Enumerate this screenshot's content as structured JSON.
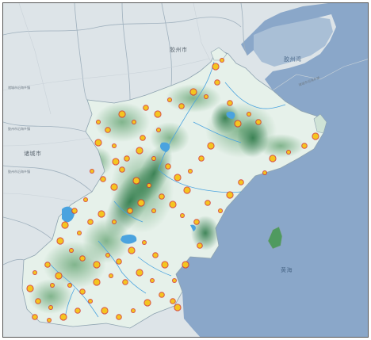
{
  "map": {
    "labels": {
      "city_east": "胶州市",
      "city_west": "诸城市",
      "bay": "胶州湾",
      "sea": "黄海",
      "road_1": "胶州市沿海乡镇",
      "road_2": "胶州市沿海乡镇",
      "road_3": "诸城市沿海乡镇",
      "road_4": "诸城市沿海乡镇"
    },
    "colors": {
      "sea": "#8aa7c9",
      "land_background": "#dde4e8",
      "terrain_low": "#e9f3ee",
      "terrain_high": "#2f7a4a",
      "river": "#4aa3df",
      "marker_fill": "#f4c51f",
      "marker_ring": "#d6362a",
      "boundary": "#9fb0bd"
    }
  }
}
